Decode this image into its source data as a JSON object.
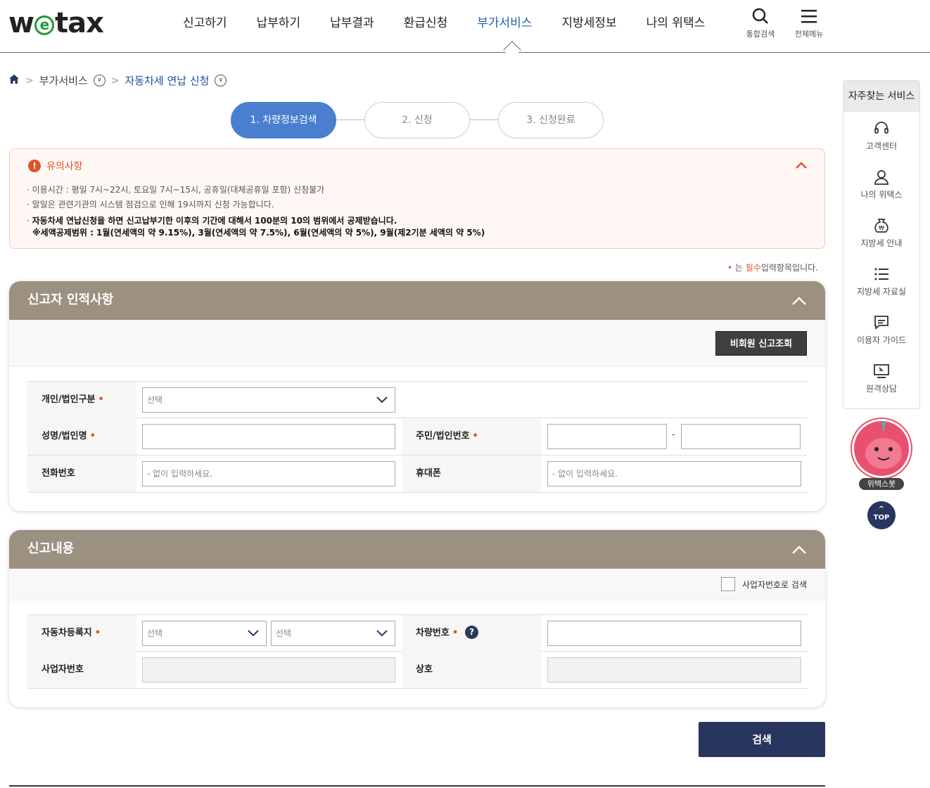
{
  "header": {
    "logo": "wetax",
    "menu": [
      "신고하기",
      "납부하기",
      "납부결과",
      "환급신청",
      "부가서비스",
      "지방세정보",
      "나의 위택스"
    ],
    "active_index": 4,
    "search_label": "통합검색",
    "all_menu_label": "전체메뉴"
  },
  "breadcrumb": {
    "level1": "부가서비스",
    "level2": "자동차세 연납 신청"
  },
  "steps": [
    "1. 차량정보검색",
    "2. 신청",
    "3. 신청완료"
  ],
  "notice": {
    "title": "유의사항",
    "items": [
      "이용시간 : 평일 7시~22시, 토요일 7시~15시, 공휴일(대체공휴일 포함) 신청불가",
      "말일은 관련기관의 시스템 점검으로 인해 19시까지 신청 가능합니다.",
      "자동차세 연납신청을 하면 신고납부기한 이후의 기간에 대해서 100분의 10의 범위에서 공제받습니다."
    ],
    "sub_item": "※세액공제범위 : 1월(연세액의 약 9.15%), 3월(연세액의 약 7.5%), 6월(연세액의 약 5%), 9월(제2기분 세액의 약 5%)"
  },
  "required_note": {
    "pre": "는",
    "must": "필수",
    "post": "입력항목입니다."
  },
  "panel1": {
    "title": "신고자 인적사항",
    "lookup_button": "비회원 신고조회",
    "type_label": "개인/법인구분",
    "type_value": "선택",
    "name_label": "성명/법인명",
    "id_label": "주민/법인번호",
    "id_sep": "-",
    "phone_label": "전화번호",
    "phone_placeholder": "- 없이 입력하세요.",
    "mobile_label": "휴대폰",
    "mobile_placeholder": "- 없이 입력하세요."
  },
  "panel2": {
    "title": "신고내용",
    "biz_check_label": "사업자번호로 검색",
    "reg_label": "자동차등록지",
    "reg_sel1": "선택",
    "reg_sel2": "선택",
    "car_label": "차량번호",
    "help_icon": "?",
    "biz_label": "사업자번호",
    "trade_label": "상호"
  },
  "search_button": "검색",
  "quick_menu": {
    "title": "자주찾는 서비스",
    "items": [
      "고객센터",
      "나의 위택스",
      "지방세 안내",
      "지방세 자료실",
      "이용자 가이드",
      "원격상담"
    ]
  },
  "bot_label": "위택스봇",
  "top_button": "TOP",
  "colors": {
    "accent": "#1f5fb3",
    "step_active": "#4a7fd0",
    "panel_header": "#9c9080",
    "required": "#e0532a",
    "primary_button": "#27355f"
  }
}
